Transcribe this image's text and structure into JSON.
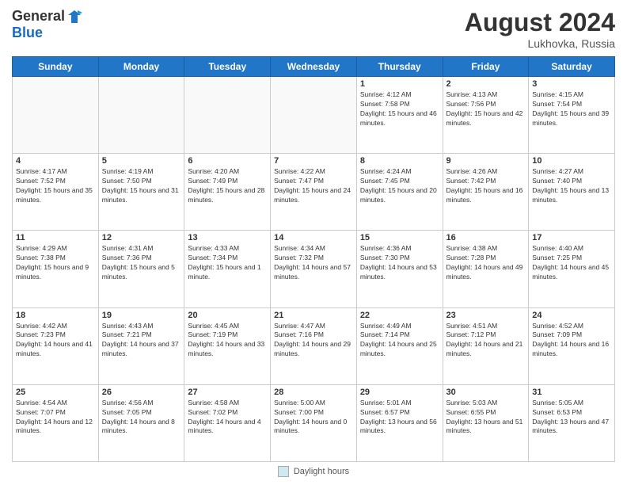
{
  "header": {
    "logo_general": "General",
    "logo_blue": "Blue",
    "title": "August 2024",
    "location": "Lukhovka, Russia"
  },
  "footer": {
    "legend_label": "Daylight hours"
  },
  "days_of_week": [
    "Sunday",
    "Monday",
    "Tuesday",
    "Wednesday",
    "Thursday",
    "Friday",
    "Saturday"
  ],
  "weeks": [
    [
      {
        "day": "",
        "info": ""
      },
      {
        "day": "",
        "info": ""
      },
      {
        "day": "",
        "info": ""
      },
      {
        "day": "",
        "info": ""
      },
      {
        "day": "1",
        "info": "Sunrise: 4:12 AM\nSunset: 7:58 PM\nDaylight: 15 hours and 46 minutes."
      },
      {
        "day": "2",
        "info": "Sunrise: 4:13 AM\nSunset: 7:56 PM\nDaylight: 15 hours and 42 minutes."
      },
      {
        "day": "3",
        "info": "Sunrise: 4:15 AM\nSunset: 7:54 PM\nDaylight: 15 hours and 39 minutes."
      }
    ],
    [
      {
        "day": "4",
        "info": "Sunrise: 4:17 AM\nSunset: 7:52 PM\nDaylight: 15 hours and 35 minutes."
      },
      {
        "day": "5",
        "info": "Sunrise: 4:19 AM\nSunset: 7:50 PM\nDaylight: 15 hours and 31 minutes."
      },
      {
        "day": "6",
        "info": "Sunrise: 4:20 AM\nSunset: 7:49 PM\nDaylight: 15 hours and 28 minutes."
      },
      {
        "day": "7",
        "info": "Sunrise: 4:22 AM\nSunset: 7:47 PM\nDaylight: 15 hours and 24 minutes."
      },
      {
        "day": "8",
        "info": "Sunrise: 4:24 AM\nSunset: 7:45 PM\nDaylight: 15 hours and 20 minutes."
      },
      {
        "day": "9",
        "info": "Sunrise: 4:26 AM\nSunset: 7:42 PM\nDaylight: 15 hours and 16 minutes."
      },
      {
        "day": "10",
        "info": "Sunrise: 4:27 AM\nSunset: 7:40 PM\nDaylight: 15 hours and 13 minutes."
      }
    ],
    [
      {
        "day": "11",
        "info": "Sunrise: 4:29 AM\nSunset: 7:38 PM\nDaylight: 15 hours and 9 minutes."
      },
      {
        "day": "12",
        "info": "Sunrise: 4:31 AM\nSunset: 7:36 PM\nDaylight: 15 hours and 5 minutes."
      },
      {
        "day": "13",
        "info": "Sunrise: 4:33 AM\nSunset: 7:34 PM\nDaylight: 15 hours and 1 minute."
      },
      {
        "day": "14",
        "info": "Sunrise: 4:34 AM\nSunset: 7:32 PM\nDaylight: 14 hours and 57 minutes."
      },
      {
        "day": "15",
        "info": "Sunrise: 4:36 AM\nSunset: 7:30 PM\nDaylight: 14 hours and 53 minutes."
      },
      {
        "day": "16",
        "info": "Sunrise: 4:38 AM\nSunset: 7:28 PM\nDaylight: 14 hours and 49 minutes."
      },
      {
        "day": "17",
        "info": "Sunrise: 4:40 AM\nSunset: 7:25 PM\nDaylight: 14 hours and 45 minutes."
      }
    ],
    [
      {
        "day": "18",
        "info": "Sunrise: 4:42 AM\nSunset: 7:23 PM\nDaylight: 14 hours and 41 minutes."
      },
      {
        "day": "19",
        "info": "Sunrise: 4:43 AM\nSunset: 7:21 PM\nDaylight: 14 hours and 37 minutes."
      },
      {
        "day": "20",
        "info": "Sunrise: 4:45 AM\nSunset: 7:19 PM\nDaylight: 14 hours and 33 minutes."
      },
      {
        "day": "21",
        "info": "Sunrise: 4:47 AM\nSunset: 7:16 PM\nDaylight: 14 hours and 29 minutes."
      },
      {
        "day": "22",
        "info": "Sunrise: 4:49 AM\nSunset: 7:14 PM\nDaylight: 14 hours and 25 minutes."
      },
      {
        "day": "23",
        "info": "Sunrise: 4:51 AM\nSunset: 7:12 PM\nDaylight: 14 hours and 21 minutes."
      },
      {
        "day": "24",
        "info": "Sunrise: 4:52 AM\nSunset: 7:09 PM\nDaylight: 14 hours and 16 minutes."
      }
    ],
    [
      {
        "day": "25",
        "info": "Sunrise: 4:54 AM\nSunset: 7:07 PM\nDaylight: 14 hours and 12 minutes."
      },
      {
        "day": "26",
        "info": "Sunrise: 4:56 AM\nSunset: 7:05 PM\nDaylight: 14 hours and 8 minutes."
      },
      {
        "day": "27",
        "info": "Sunrise: 4:58 AM\nSunset: 7:02 PM\nDaylight: 14 hours and 4 minutes."
      },
      {
        "day": "28",
        "info": "Sunrise: 5:00 AM\nSunset: 7:00 PM\nDaylight: 14 hours and 0 minutes."
      },
      {
        "day": "29",
        "info": "Sunrise: 5:01 AM\nSunset: 6:57 PM\nDaylight: 13 hours and 56 minutes."
      },
      {
        "day": "30",
        "info": "Sunrise: 5:03 AM\nSunset: 6:55 PM\nDaylight: 13 hours and 51 minutes."
      },
      {
        "day": "31",
        "info": "Sunrise: 5:05 AM\nSunset: 6:53 PM\nDaylight: 13 hours and 47 minutes."
      }
    ]
  ]
}
